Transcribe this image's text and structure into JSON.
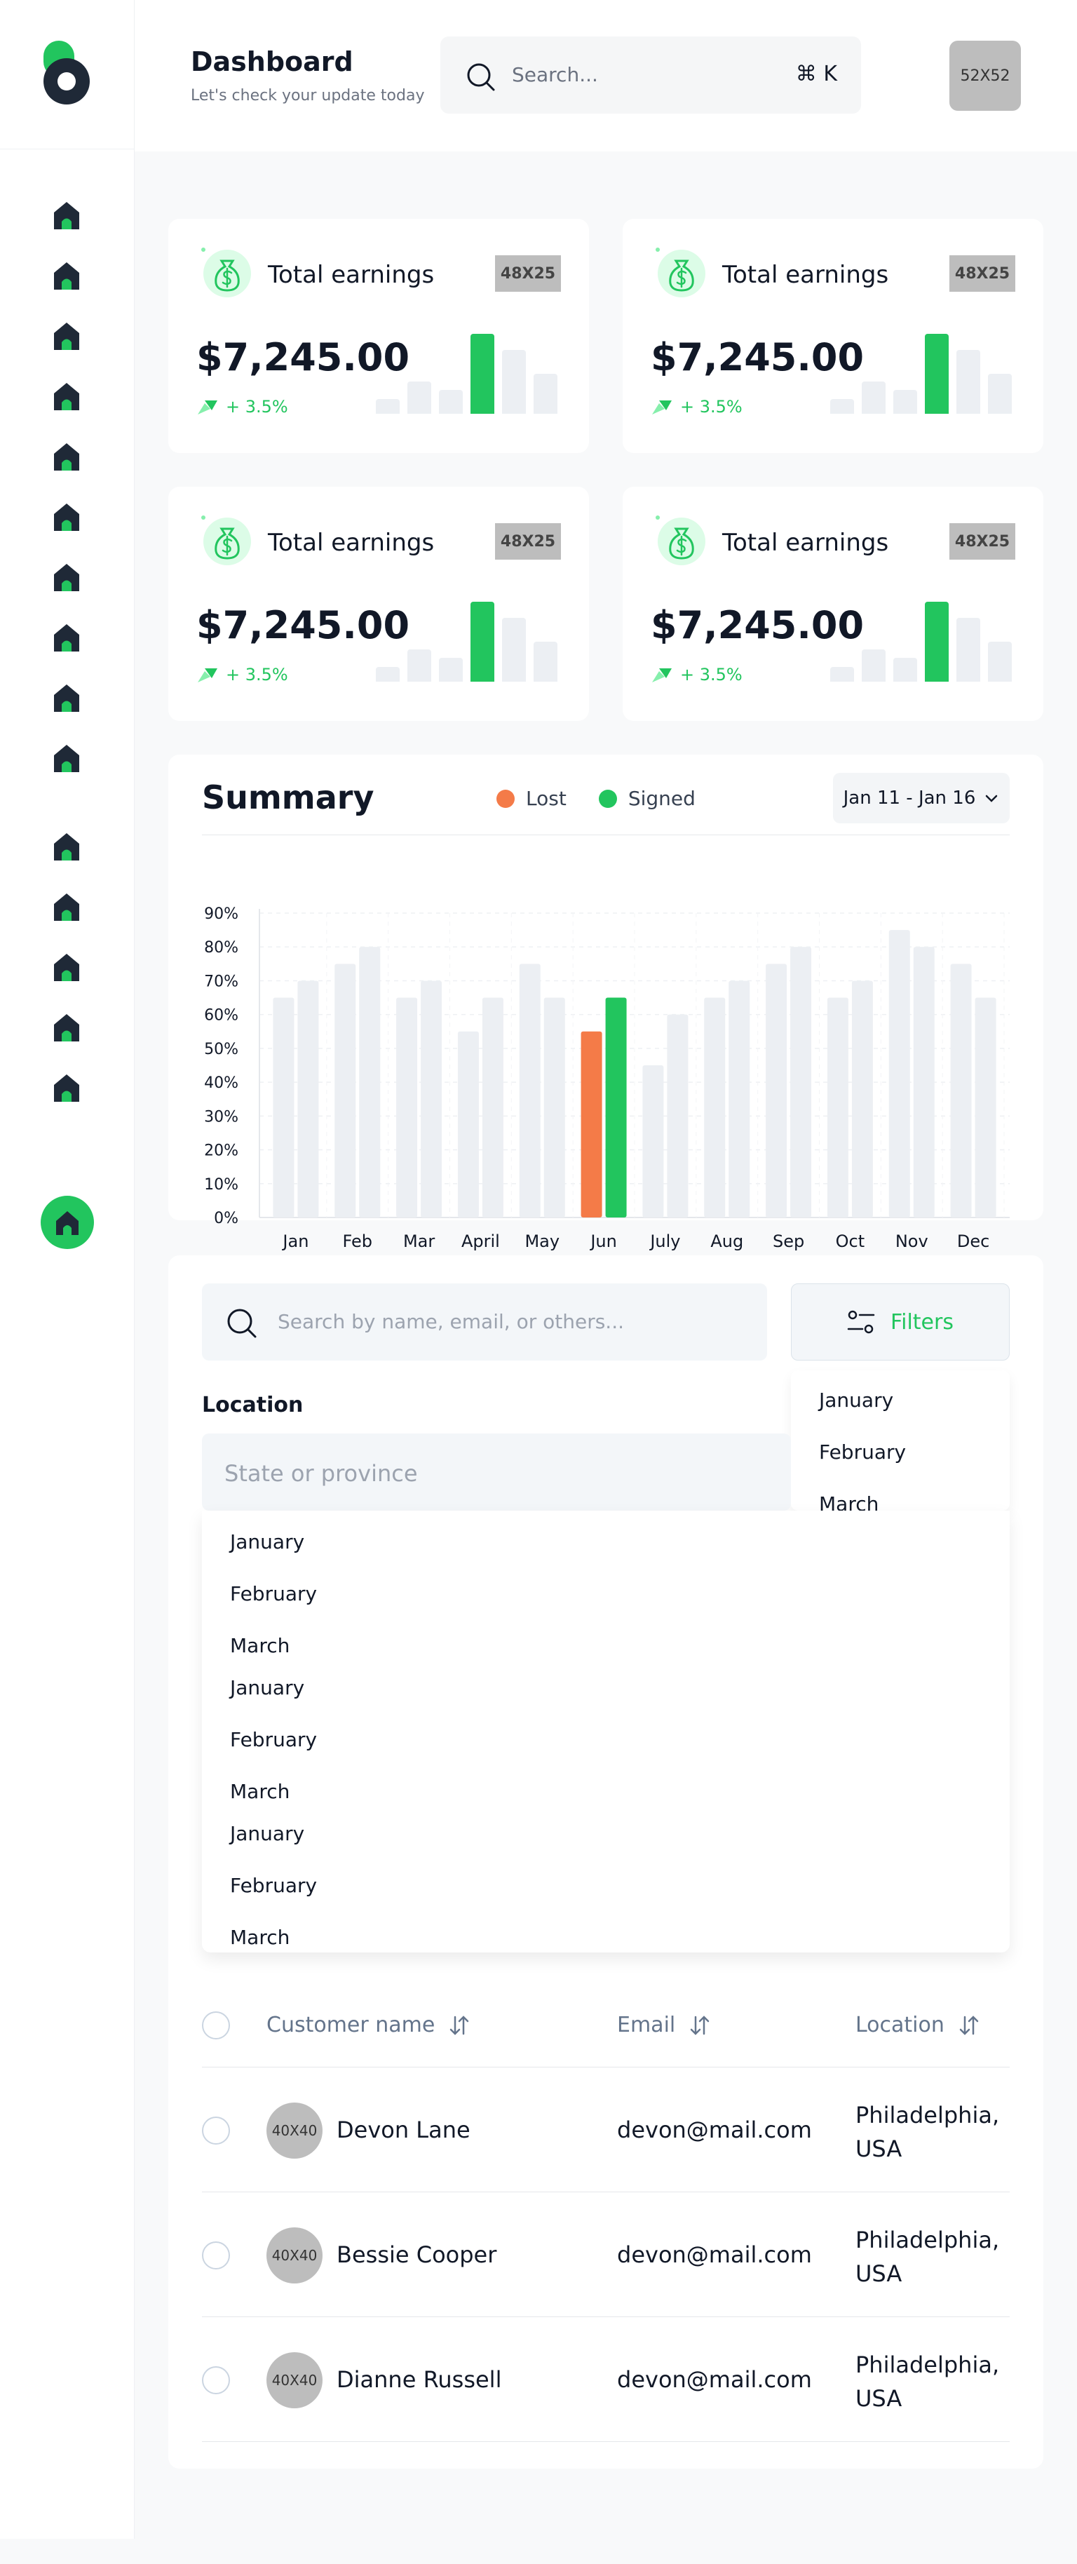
{
  "header": {
    "title": "Dashboard",
    "subtitle": "Let's check your update today",
    "search_placeholder": "Search...",
    "search_shortcut": "⌘ K",
    "avatar_placeholder": "52X52"
  },
  "sidebar": {
    "logo": "logo-icon",
    "nav_icon": "home-icon",
    "nav_count": 15,
    "active_icon": "home-icon"
  },
  "cards": [
    {
      "title": "Total earnings",
      "placeholder": "48X25",
      "value": "$7,245.00",
      "trend": "+ 3.5%",
      "icon": "money-bag-icon",
      "mini_bars": [
        0.18,
        0.4,
        0.3,
        1.0,
        0.8,
        0.5
      ]
    },
    {
      "title": "Total earnings",
      "placeholder": "48X25",
      "value": "$7,245.00",
      "trend": "+ 3.5%",
      "icon": "money-bag-icon",
      "mini_bars": [
        0.18,
        0.4,
        0.3,
        1.0,
        0.8,
        0.5
      ]
    },
    {
      "title": "Total earnings",
      "placeholder": "48X25",
      "value": "$7,245.00",
      "trend": "+ 3.5%",
      "icon": "money-bag-icon",
      "mini_bars": [
        0.18,
        0.4,
        0.3,
        1.0,
        0.8,
        0.5
      ]
    },
    {
      "title": "Total earnings",
      "placeholder": "48X25",
      "value": "$7,245.00",
      "trend": "+ 3.5%",
      "icon": "money-bag-icon",
      "mini_bars": [
        0.18,
        0.4,
        0.3,
        1.0,
        0.8,
        0.5
      ]
    }
  ],
  "summary": {
    "title": "Summary",
    "legend": [
      {
        "label": "Lost",
        "color": "#f47b48"
      },
      {
        "label": "Signed",
        "color": "#22c55e"
      }
    ],
    "date_range": "Jan 11 - Jan 16"
  },
  "chart_data": {
    "type": "bar",
    "categories": [
      "Jan",
      "Feb",
      "Mar",
      "April",
      "May",
      "Jun",
      "July",
      "Aug",
      "Sep",
      "Oct",
      "Nov",
      "Dec"
    ],
    "series": [
      {
        "name": "Lost",
        "values": [
          65,
          75,
          65,
          55,
          75,
          55,
          45,
          65,
          75,
          65,
          85,
          75
        ]
      },
      {
        "name": "Signed",
        "values": [
          70,
          80,
          70,
          65,
          65,
          65,
          60,
          70,
          80,
          70,
          80,
          65
        ]
      }
    ],
    "highlighted_category": "Jun",
    "ylim": [
      0,
      90
    ],
    "yticks": [
      "0%",
      "10%",
      "20%",
      "30%",
      "40%",
      "50%",
      "60%",
      "70%",
      "80%",
      "90%"
    ],
    "grid": true,
    "colors": {
      "inactive": "#eceff3",
      "lost": "#f47b48",
      "signed": "#22c55e"
    }
  },
  "filters": {
    "search_placeholder": "Search by name, email, or others...",
    "filters_label": "Filters",
    "filters_dropdown": [
      "January",
      "February",
      "March"
    ],
    "location_label": "Location",
    "location_placeholder": "State or province",
    "location_dropdown": [
      "January",
      "February",
      "March",
      "January",
      "February",
      "March",
      "January",
      "February",
      "March"
    ]
  },
  "table": {
    "columns": [
      "Customer name",
      "Email",
      "Location"
    ],
    "rows": [
      {
        "avatar": "40X40",
        "name": "Devon Lane",
        "email": "devon@mail.com",
        "location": "Philadelphia, USA"
      },
      {
        "avatar": "40X40",
        "name": "Bessie Cooper",
        "email": "devon@mail.com",
        "location": "Philadelphia, USA"
      },
      {
        "avatar": "40X40",
        "name": "Dianne Russell",
        "email": "devon@mail.com",
        "location": "Philadelphia, USA"
      }
    ]
  }
}
